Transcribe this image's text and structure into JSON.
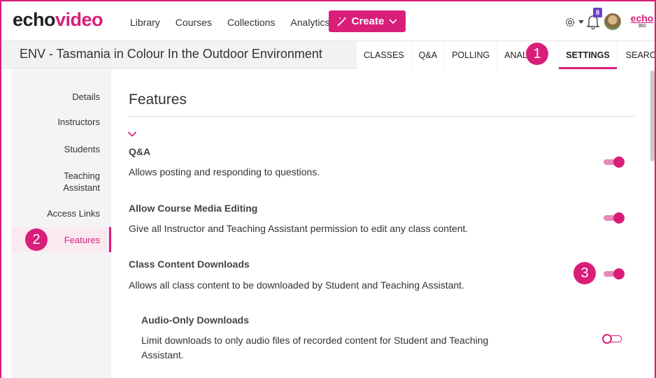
{
  "app": {
    "logo_prefix": "echo",
    "logo_suffix": "video",
    "nav": [
      "Library",
      "Courses",
      "Collections",
      "Analytics"
    ],
    "create_label": "Create",
    "notification_count": "8",
    "brand_name": "echo",
    "brand_suffix": "360"
  },
  "course": {
    "title": "ENV - Tasmania in Colour In the Outdoor Environment",
    "tabs": [
      "CLASSES",
      "Q&A",
      "POLLING",
      "ANALYT",
      "SETTINGS",
      "SEARCH"
    ],
    "active_tab": "SETTINGS"
  },
  "sidebar": {
    "items": [
      "Details",
      "Instructors",
      "Students",
      "Teaching",
      "Assistant",
      "Access Links",
      "Features"
    ],
    "active": "Features"
  },
  "main": {
    "title": "Features",
    "features": [
      {
        "title": "Q&A",
        "description": "Allows posting and responding to questions.",
        "enabled": true
      },
      {
        "title": "Allow Course Media Editing",
        "description": "Give all Instructor and Teaching Assistant permission to edit any class content.",
        "enabled": true
      },
      {
        "title": "Class Content Downloads",
        "description": "Allows all class content to be downloaded by Student and Teaching Assistant.",
        "enabled": true
      },
      {
        "title": "Audio-Only Downloads",
        "description_line1": "Limit downloads to only audio files of recorded content for Student and Teaching",
        "description_line2": "Assistant.",
        "enabled": false
      }
    ]
  },
  "markers": [
    "1",
    "2",
    "3"
  ],
  "colors": {
    "accent": "#d81e79",
    "badge": "#6b3fc8"
  }
}
